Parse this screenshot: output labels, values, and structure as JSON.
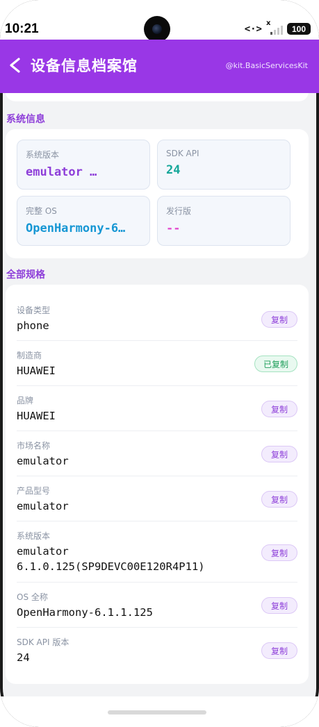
{
  "status_bar": {
    "time": "10:21",
    "nfc_glyph": "<·>",
    "signal_x": "x",
    "battery": "100"
  },
  "header": {
    "back_glyph": "<",
    "title": "设备信息档案馆",
    "kit": "@kit.BasicServicesKit"
  },
  "system_info": {
    "section_title": "系统信息",
    "tiles": [
      {
        "label": "系统版本",
        "value": "emulator …",
        "color": "#8e3fd9"
      },
      {
        "label": "SDK API",
        "value": "24",
        "color": "#16a79a"
      },
      {
        "label": "完整 OS",
        "value": "OpenHarmony-6…",
        "color": "#1797d4"
      },
      {
        "label": "发行版",
        "value": "--",
        "color": "#e44fcf"
      }
    ]
  },
  "specs": {
    "section_title": "全部规格",
    "copy_label": "复制",
    "copied_label": "已复制",
    "rows": [
      {
        "label": "设备类型",
        "value": "phone",
        "copied": false
      },
      {
        "label": "制造商",
        "value": "HUAWEI",
        "copied": true
      },
      {
        "label": "品牌",
        "value": "HUAWEI",
        "copied": false
      },
      {
        "label": "市场名称",
        "value": "emulator",
        "copied": false
      },
      {
        "label": "产品型号",
        "value": "emulator",
        "copied": false
      },
      {
        "label": "系统版本",
        "value": "emulator\n6.1.0.125(SP9DEVC00E120R4P11)",
        "copied": false
      },
      {
        "label": "OS 全称",
        "value": "OpenHarmony-6.1.1.125",
        "copied": false
      },
      {
        "label": "SDK API 版本",
        "value": "24",
        "copied": false
      }
    ]
  },
  "colors": {
    "brand": "#9937e6",
    "accent_text": "#8e3fd9",
    "copied_green": "#1e9e5a"
  }
}
